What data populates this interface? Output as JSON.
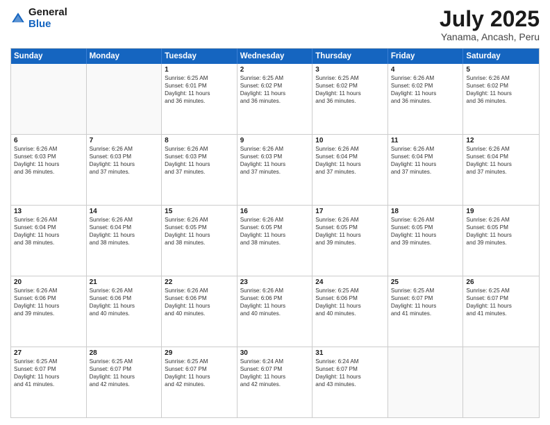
{
  "logo": {
    "general": "General",
    "blue": "Blue"
  },
  "header": {
    "title": "July 2025",
    "subtitle": "Yanama, Ancash, Peru"
  },
  "weekdays": [
    "Sunday",
    "Monday",
    "Tuesday",
    "Wednesday",
    "Thursday",
    "Friday",
    "Saturday"
  ],
  "weeks": [
    [
      {
        "day": "",
        "sunrise": "",
        "sunset": "",
        "daylight": ""
      },
      {
        "day": "",
        "sunrise": "",
        "sunset": "",
        "daylight": ""
      },
      {
        "day": "1",
        "sunrise": "Sunrise: 6:25 AM",
        "sunset": "Sunset: 6:01 PM",
        "daylight": "Daylight: 11 hours and 36 minutes."
      },
      {
        "day": "2",
        "sunrise": "Sunrise: 6:25 AM",
        "sunset": "Sunset: 6:02 PM",
        "daylight": "Daylight: 11 hours and 36 minutes."
      },
      {
        "day": "3",
        "sunrise": "Sunrise: 6:25 AM",
        "sunset": "Sunset: 6:02 PM",
        "daylight": "Daylight: 11 hours and 36 minutes."
      },
      {
        "day": "4",
        "sunrise": "Sunrise: 6:26 AM",
        "sunset": "Sunset: 6:02 PM",
        "daylight": "Daylight: 11 hours and 36 minutes."
      },
      {
        "day": "5",
        "sunrise": "Sunrise: 6:26 AM",
        "sunset": "Sunset: 6:02 PM",
        "daylight": "Daylight: 11 hours and 36 minutes."
      }
    ],
    [
      {
        "day": "6",
        "sunrise": "Sunrise: 6:26 AM",
        "sunset": "Sunset: 6:03 PM",
        "daylight": "Daylight: 11 hours and 36 minutes."
      },
      {
        "day": "7",
        "sunrise": "Sunrise: 6:26 AM",
        "sunset": "Sunset: 6:03 PM",
        "daylight": "Daylight: 11 hours and 37 minutes."
      },
      {
        "day": "8",
        "sunrise": "Sunrise: 6:26 AM",
        "sunset": "Sunset: 6:03 PM",
        "daylight": "Daylight: 11 hours and 37 minutes."
      },
      {
        "day": "9",
        "sunrise": "Sunrise: 6:26 AM",
        "sunset": "Sunset: 6:03 PM",
        "daylight": "Daylight: 11 hours and 37 minutes."
      },
      {
        "day": "10",
        "sunrise": "Sunrise: 6:26 AM",
        "sunset": "Sunset: 6:04 PM",
        "daylight": "Daylight: 11 hours and 37 minutes."
      },
      {
        "day": "11",
        "sunrise": "Sunrise: 6:26 AM",
        "sunset": "Sunset: 6:04 PM",
        "daylight": "Daylight: 11 hours and 37 minutes."
      },
      {
        "day": "12",
        "sunrise": "Sunrise: 6:26 AM",
        "sunset": "Sunset: 6:04 PM",
        "daylight": "Daylight: 11 hours and 37 minutes."
      }
    ],
    [
      {
        "day": "13",
        "sunrise": "Sunrise: 6:26 AM",
        "sunset": "Sunset: 6:04 PM",
        "daylight": "Daylight: 11 hours and 38 minutes."
      },
      {
        "day": "14",
        "sunrise": "Sunrise: 6:26 AM",
        "sunset": "Sunset: 6:04 PM",
        "daylight": "Daylight: 11 hours and 38 minutes."
      },
      {
        "day": "15",
        "sunrise": "Sunrise: 6:26 AM",
        "sunset": "Sunset: 6:05 PM",
        "daylight": "Daylight: 11 hours and 38 minutes."
      },
      {
        "day": "16",
        "sunrise": "Sunrise: 6:26 AM",
        "sunset": "Sunset: 6:05 PM",
        "daylight": "Daylight: 11 hours and 38 minutes."
      },
      {
        "day": "17",
        "sunrise": "Sunrise: 6:26 AM",
        "sunset": "Sunset: 6:05 PM",
        "daylight": "Daylight: 11 hours and 39 minutes."
      },
      {
        "day": "18",
        "sunrise": "Sunrise: 6:26 AM",
        "sunset": "Sunset: 6:05 PM",
        "daylight": "Daylight: 11 hours and 39 minutes."
      },
      {
        "day": "19",
        "sunrise": "Sunrise: 6:26 AM",
        "sunset": "Sunset: 6:05 PM",
        "daylight": "Daylight: 11 hours and 39 minutes."
      }
    ],
    [
      {
        "day": "20",
        "sunrise": "Sunrise: 6:26 AM",
        "sunset": "Sunset: 6:06 PM",
        "daylight": "Daylight: 11 hours and 39 minutes."
      },
      {
        "day": "21",
        "sunrise": "Sunrise: 6:26 AM",
        "sunset": "Sunset: 6:06 PM",
        "daylight": "Daylight: 11 hours and 40 minutes."
      },
      {
        "day": "22",
        "sunrise": "Sunrise: 6:26 AM",
        "sunset": "Sunset: 6:06 PM",
        "daylight": "Daylight: 11 hours and 40 minutes."
      },
      {
        "day": "23",
        "sunrise": "Sunrise: 6:26 AM",
        "sunset": "Sunset: 6:06 PM",
        "daylight": "Daylight: 11 hours and 40 minutes."
      },
      {
        "day": "24",
        "sunrise": "Sunrise: 6:25 AM",
        "sunset": "Sunset: 6:06 PM",
        "daylight": "Daylight: 11 hours and 40 minutes."
      },
      {
        "day": "25",
        "sunrise": "Sunrise: 6:25 AM",
        "sunset": "Sunset: 6:07 PM",
        "daylight": "Daylight: 11 hours and 41 minutes."
      },
      {
        "day": "26",
        "sunrise": "Sunrise: 6:25 AM",
        "sunset": "Sunset: 6:07 PM",
        "daylight": "Daylight: 11 hours and 41 minutes."
      }
    ],
    [
      {
        "day": "27",
        "sunrise": "Sunrise: 6:25 AM",
        "sunset": "Sunset: 6:07 PM",
        "daylight": "Daylight: 11 hours and 41 minutes."
      },
      {
        "day": "28",
        "sunrise": "Sunrise: 6:25 AM",
        "sunset": "Sunset: 6:07 PM",
        "daylight": "Daylight: 11 hours and 42 minutes."
      },
      {
        "day": "29",
        "sunrise": "Sunrise: 6:25 AM",
        "sunset": "Sunset: 6:07 PM",
        "daylight": "Daylight: 11 hours and 42 minutes."
      },
      {
        "day": "30",
        "sunrise": "Sunrise: 6:24 AM",
        "sunset": "Sunset: 6:07 PM",
        "daylight": "Daylight: 11 hours and 42 minutes."
      },
      {
        "day": "31",
        "sunrise": "Sunrise: 6:24 AM",
        "sunset": "Sunset: 6:07 PM",
        "daylight": "Daylight: 11 hours and 43 minutes."
      },
      {
        "day": "",
        "sunrise": "",
        "sunset": "",
        "daylight": ""
      },
      {
        "day": "",
        "sunrise": "",
        "sunset": "",
        "daylight": ""
      }
    ]
  ]
}
